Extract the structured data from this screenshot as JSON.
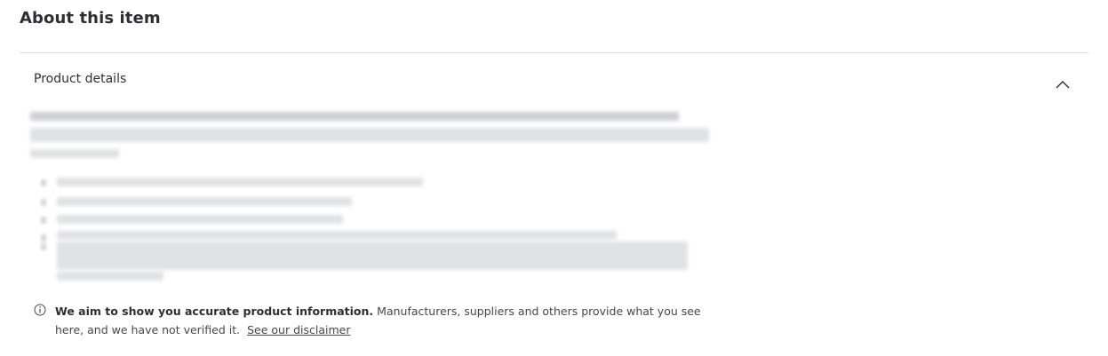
{
  "section": {
    "title": "About this item"
  },
  "accordion": {
    "label": "Product details",
    "expanded": true,
    "chevron_icon": "chevron-up-icon"
  },
  "notice": {
    "icon": "info-icon",
    "bold_text": "We aim to show you accurate product information.",
    "body_text": "Manufacturers, suppliers and others provide what you see here, and we have not verified it.",
    "link_label": "See our disclaimer"
  },
  "colors": {
    "text": "#2e2f32",
    "divider": "#dadcde",
    "blurred_text": "#cfd0d3"
  }
}
